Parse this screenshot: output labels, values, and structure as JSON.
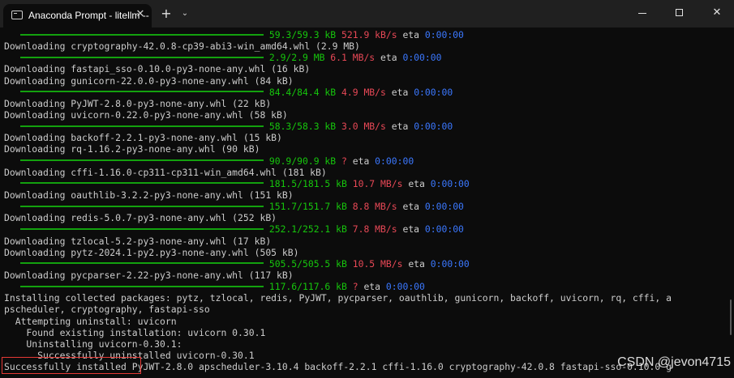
{
  "window": {
    "tab_title": "Anaconda Prompt - litellm --",
    "tab_close": "✕",
    "new_tab": "+",
    "dropdown": "⌄",
    "minimize": "",
    "maximize": "",
    "close": "✕"
  },
  "lines": [
    {
      "kind": "progress",
      "size": "59.3/59.3 kB",
      "speed": "521.9 kB/s",
      "eta_label": "eta",
      "eta": "0:00:00"
    },
    {
      "kind": "text",
      "text": "Downloading cryptography-42.0.8-cp39-abi3-win_amd64.whl (2.9 MB)"
    },
    {
      "kind": "progress",
      "size": "2.9/2.9 MB",
      "speed": "6.1 MB/s",
      "eta_label": "eta",
      "eta": "0:00:00"
    },
    {
      "kind": "text",
      "text": "Downloading fastapi_sso-0.10.0-py3-none-any.whl (16 kB)"
    },
    {
      "kind": "text",
      "text": "Downloading gunicorn-22.0.0-py3-none-any.whl (84 kB)"
    },
    {
      "kind": "progress",
      "size": "84.4/84.4 kB",
      "speed": "4.9 MB/s",
      "eta_label": "eta",
      "eta": "0:00:00"
    },
    {
      "kind": "text",
      "text": "Downloading PyJWT-2.8.0-py3-none-any.whl (22 kB)"
    },
    {
      "kind": "text",
      "text": "Downloading uvicorn-0.22.0-py3-none-any.whl (58 kB)"
    },
    {
      "kind": "progress",
      "size": "58.3/58.3 kB",
      "speed": "3.0 MB/s",
      "eta_label": "eta",
      "eta": "0:00:00"
    },
    {
      "kind": "text",
      "text": "Downloading backoff-2.2.1-py3-none-any.whl (15 kB)"
    },
    {
      "kind": "text",
      "text": "Downloading rq-1.16.2-py3-none-any.whl (90 kB)"
    },
    {
      "kind": "progress",
      "size": "90.9/90.9 kB",
      "speed": "?",
      "eta_label": "eta",
      "eta": "0:00:00"
    },
    {
      "kind": "text",
      "text": "Downloading cffi-1.16.0-cp311-cp311-win_amd64.whl (181 kB)"
    },
    {
      "kind": "progress",
      "size": "181.5/181.5 kB",
      "speed": "10.7 MB/s",
      "eta_label": "eta",
      "eta": "0:00:00"
    },
    {
      "kind": "text",
      "text": "Downloading oauthlib-3.2.2-py3-none-any.whl (151 kB)"
    },
    {
      "kind": "progress",
      "size": "151.7/151.7 kB",
      "speed": "8.8 MB/s",
      "eta_label": "eta",
      "eta": "0:00:00"
    },
    {
      "kind": "text",
      "text": "Downloading redis-5.0.7-py3-none-any.whl (252 kB)"
    },
    {
      "kind": "progress",
      "size": "252.1/252.1 kB",
      "speed": "7.8 MB/s",
      "eta_label": "eta",
      "eta": "0:00:00"
    },
    {
      "kind": "text",
      "text": "Downloading tzlocal-5.2-py3-none-any.whl (17 kB)"
    },
    {
      "kind": "text",
      "text": "Downloading pytz-2024.1-py2.py3-none-any.whl (505 kB)"
    },
    {
      "kind": "progress",
      "size": "505.5/505.5 kB",
      "speed": "10.5 MB/s",
      "eta_label": "eta",
      "eta": "0:00:00"
    },
    {
      "kind": "text",
      "text": "Downloading pycparser-2.22-py3-none-any.whl (117 kB)"
    },
    {
      "kind": "progress",
      "size": "117.6/117.6 kB",
      "speed": "?",
      "eta_label": "eta",
      "eta": "0:00:00"
    },
    {
      "kind": "text",
      "text": "Installing collected packages: pytz, tzlocal, redis, PyJWT, pycparser, oauthlib, gunicorn, backoff, uvicorn, rq, cffi, a"
    },
    {
      "kind": "text",
      "text": "pscheduler, cryptography, fastapi-sso"
    },
    {
      "kind": "text",
      "text": "  Attempting uninstall: uvicorn"
    },
    {
      "kind": "text",
      "text": "    Found existing installation: uvicorn 0.30.1"
    },
    {
      "kind": "text",
      "text": "    Uninstalling uvicorn-0.30.1:"
    },
    {
      "kind": "text",
      "text": "      Successfully uninstalled uvicorn-0.30.1"
    },
    {
      "kind": "text",
      "text": "Successfully installed PyJWT-2.8.0 apscheduler-3.10.4 backoff-2.2.1 cffi-1.16.0 cryptography-42.0.8 fastapi-sso-0.10.0 g"
    }
  ],
  "watermark": "CSDN @jevon4715",
  "colors": {
    "progress_bar": "#13a10e",
    "size": "#16c60c",
    "speed": "#e74856",
    "eta": "#3b78ff",
    "highlight": "#e53935"
  }
}
